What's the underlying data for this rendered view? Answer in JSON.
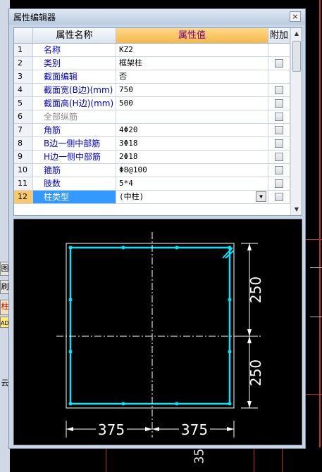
{
  "window": {
    "title": "属性编辑器",
    "close_label": "×"
  },
  "grid": {
    "headers": {
      "name": "属性名称",
      "value": "属性值",
      "add": "附加"
    },
    "rows": [
      {
        "no": "1",
        "name": "名称",
        "value": "KZ2",
        "has_check": false,
        "gray": false
      },
      {
        "no": "2",
        "name": "类别",
        "value": "框架柱",
        "has_check": true,
        "gray": false
      },
      {
        "no": "3",
        "name": "截面编辑",
        "value": "否",
        "has_check": false,
        "gray": false
      },
      {
        "no": "4",
        "name": "截面宽(B边)(mm)",
        "value": "750",
        "has_check": true,
        "gray": false
      },
      {
        "no": "5",
        "name": "截面高(H边)(mm)",
        "value": "500",
        "has_check": true,
        "gray": false
      },
      {
        "no": "6",
        "name": "全部纵筋",
        "value": "",
        "has_check": true,
        "gray": true
      },
      {
        "no": "7",
        "name": "角筋",
        "value": "4Φ20",
        "has_check": true,
        "gray": false
      },
      {
        "no": "8",
        "name": "B边一侧中部筋",
        "value": "3Φ18",
        "has_check": true,
        "gray": false
      },
      {
        "no": "9",
        "name": "H边一侧中部筋",
        "value": "2Φ18",
        "has_check": true,
        "gray": false
      },
      {
        "no": "10",
        "name": "箍筋",
        "value": "Φ8@100",
        "has_check": true,
        "gray": false
      },
      {
        "no": "11",
        "name": "肢数",
        "value": "5*4",
        "has_check": true,
        "gray": false
      },
      {
        "no": "12",
        "name": "柱类型",
        "value": "(中柱)",
        "has_check": true,
        "gray": false
      }
    ],
    "selected_row": 12
  },
  "section": {
    "dim_top": "250",
    "dim_bottom": "250",
    "dim_left": "375",
    "dim_right": "375",
    "rebar_color": "#00e5ff",
    "line_color": "#ffffff"
  },
  "background": {
    "strip_labels": [
      "图",
      "刷",
      "柱",
      "ADI"
    ],
    "bottom_number": "35",
    "side_char": "云"
  }
}
